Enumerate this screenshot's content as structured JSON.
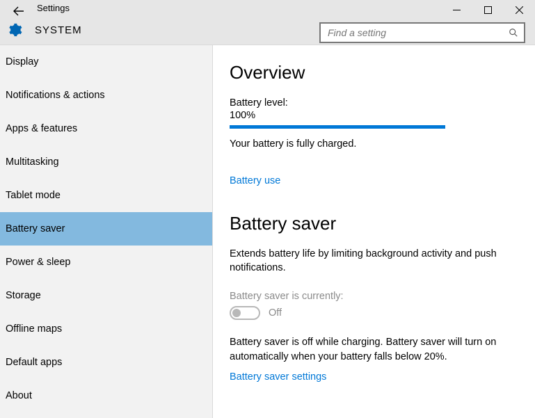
{
  "window": {
    "app_title": "Settings",
    "system_label": "SYSTEM",
    "search_placeholder": "Find a setting"
  },
  "sidebar": {
    "items": [
      {
        "label": "Display"
      },
      {
        "label": "Notifications & actions"
      },
      {
        "label": "Apps & features"
      },
      {
        "label": "Multitasking"
      },
      {
        "label": "Tablet mode"
      },
      {
        "label": "Battery saver"
      },
      {
        "label": "Power & sleep"
      },
      {
        "label": "Storage"
      },
      {
        "label": "Offline maps"
      },
      {
        "label": "Default apps"
      },
      {
        "label": "About"
      }
    ],
    "selected_index": 5
  },
  "overview": {
    "heading": "Overview",
    "battery_label": "Battery level:",
    "battery_value": "100%",
    "battery_percent": 100,
    "charged_text": "Your battery is fully charged.",
    "battery_use_link": "Battery use"
  },
  "battery_saver": {
    "heading": "Battery saver",
    "description": "Extends battery life by limiting background activity and push notifications.",
    "current_label": "Battery saver is currently:",
    "toggle_state": "Off",
    "off_text": "Battery saver is off while charging. Battery saver will turn on automatically when your battery falls below 20%.",
    "settings_link": "Battery saver settings"
  }
}
